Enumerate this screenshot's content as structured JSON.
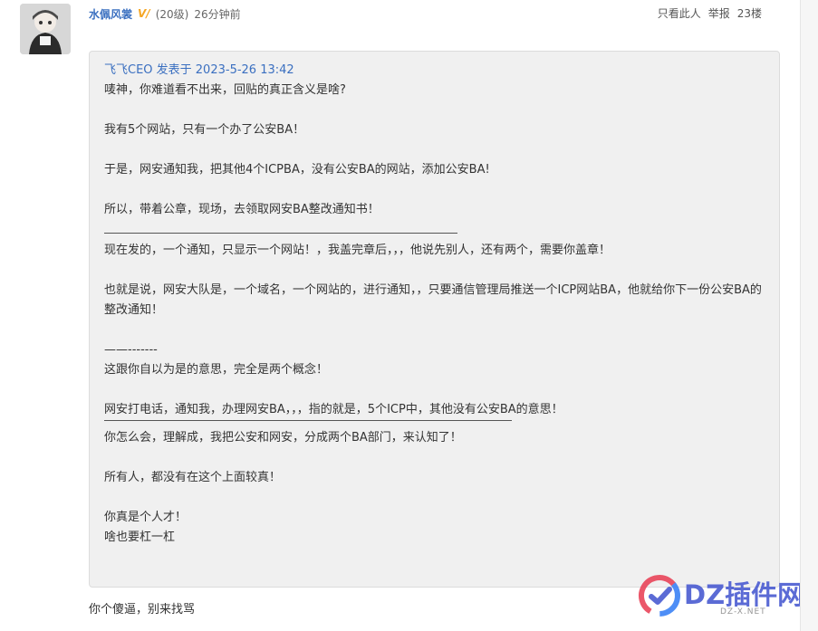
{
  "post": {
    "author": "水佩风裳",
    "badge": "V/",
    "level": "(20级)",
    "time": "26分钟前",
    "actions": {
      "only_author": "只看此人",
      "report": "举报",
      "floor": "23楼"
    }
  },
  "quote": {
    "header": "飞飞CEO 发表于 2023-5-26 13:42",
    "lines": [
      "唛神，你难道看不出来，回贴的真正含义是啥?",
      "我有5个网站，只有一个办了公安BA！",
      "于是，网安通知我，把其他4个ICPBA，没有公安BA的网站，添加公安BA!",
      "所以，带着公章，现场，去领取网安BA整改通知书！",
      "现在发的，一个通知，只显示一个网站！，我盖完章后，，，他说先别人，还有两个，需要你盖章！",
      "也就是说，网安大队是，一个域名，一个网站的，进行通知，，只要通信管理局推送一个ICP网站BA，他就给你下一份公安BA的整改通知！",
      "——-------",
      "这跟你自以为是的意思，完全是两个概念！",
      "网安打电话，通知我，办理网安BA，，，指的就是，5个ICP中，其他没有公安BA的意思！",
      "你怎么会，理解成，我把公安和网安，分成两个BA部门，来认知了！",
      "所有人，都没有在这个上面较真！",
      "你真是个人才！",
      "啥也要杠一杠"
    ]
  },
  "reply": "你个傻逼，别来找骂",
  "watermark": {
    "brand": "DZ插件网",
    "domain": "DZ-X.NET"
  },
  "colors": {
    "link_blue": "#3a6fc0",
    "badge_orange": "#f5a623",
    "quote_bg": "#f0f0f0",
    "watermark_blue": "#4a5bd1"
  }
}
